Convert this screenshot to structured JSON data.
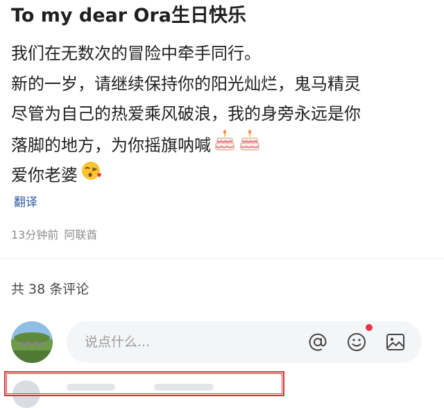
{
  "post": {
    "title": "To my dear Ora生日快乐",
    "lines": [
      "我们在无数次的冒险中牵手同行。",
      "新的一岁，请继续保持你的阳光灿烂，鬼马精灵",
      "尽管为自己的热爱乘风破浪，我的身旁永远是你",
      "落脚的地方，为你摇旗呐喊",
      "爱你老婆"
    ],
    "emojis": {
      "line4": [
        "birthday-cake",
        "birthday-cake"
      ],
      "line5": [
        "face-blowing-kiss"
      ]
    },
    "translate_label": "翻译",
    "time_ago": "13分钟前",
    "location": "阿联酋"
  },
  "comments": {
    "count_label": "共 38 条评论",
    "input_placeholder": "说点什么...",
    "icons": [
      "at-icon",
      "emoji-icon",
      "image-icon"
    ],
    "emoji_icon_has_notification": true
  },
  "colors": {
    "link": "#2b5a9c",
    "meta": "#8d8d8d",
    "input_bg": "#f4f5f7",
    "notification": "#e8324a",
    "highlight": "#d63333"
  }
}
